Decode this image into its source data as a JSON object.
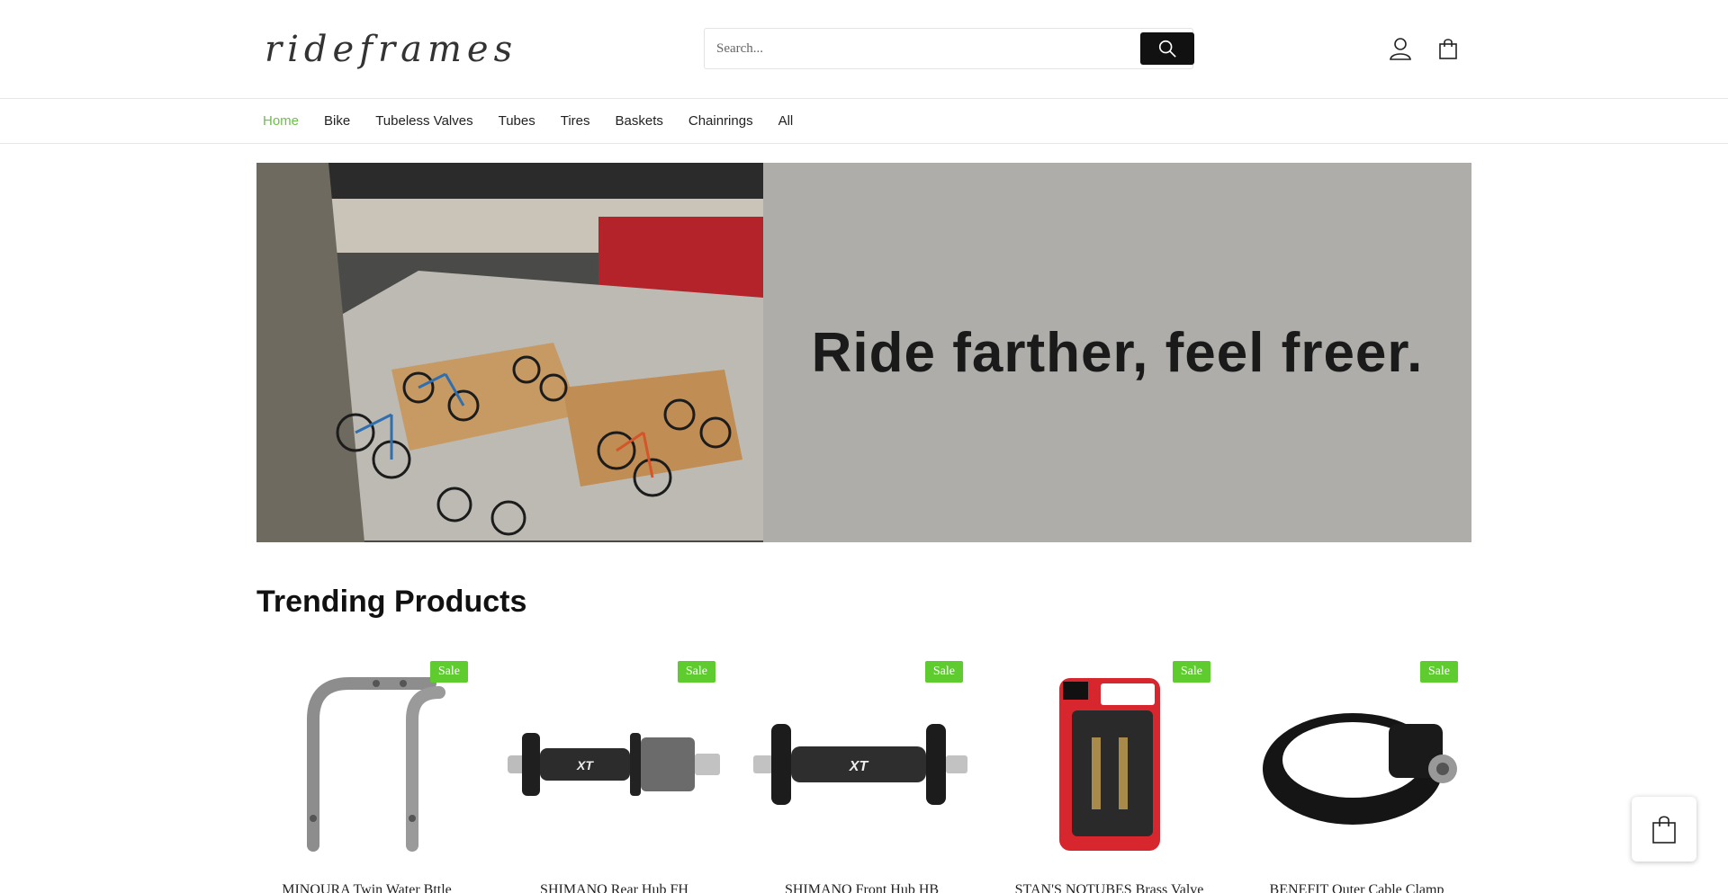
{
  "header": {
    "logo_text": "rideframes",
    "search": {
      "placeholder": "Search...",
      "value": ""
    },
    "icons": [
      "search-icon",
      "user-icon",
      "shopping-bag-icon"
    ]
  },
  "nav": {
    "items": [
      {
        "label": "Home",
        "active": true
      },
      {
        "label": "Bike",
        "active": false
      },
      {
        "label": "Tubeless Valves",
        "active": false
      },
      {
        "label": "Tubes",
        "active": false
      },
      {
        "label": "Tires",
        "active": false
      },
      {
        "label": "Baskets",
        "active": false
      },
      {
        "label": "Chainrings",
        "active": false
      },
      {
        "label": "All",
        "active": false
      }
    ]
  },
  "hero": {
    "headline": "Ride farther, feel freer."
  },
  "trending": {
    "title": "Trending Products",
    "products": [
      {
        "name": "MINOURA Twin Water Bttle",
        "badge": "Sale"
      },
      {
        "name": "SHIMANO Rear Hub FH",
        "badge": "Sale"
      },
      {
        "name": "SHIMANO Front Hub HB",
        "badge": "Sale"
      },
      {
        "name": "STAN'S NOTUBES Brass Valve",
        "badge": "Sale"
      },
      {
        "name": "BENEFIT Outer Cable Clamp",
        "badge": "Sale"
      }
    ]
  },
  "colors": {
    "accent": "#6cc04a",
    "sale_badge": "#5ecb2e",
    "hero_bg": "#aeadaa",
    "search_button": "#111111"
  }
}
